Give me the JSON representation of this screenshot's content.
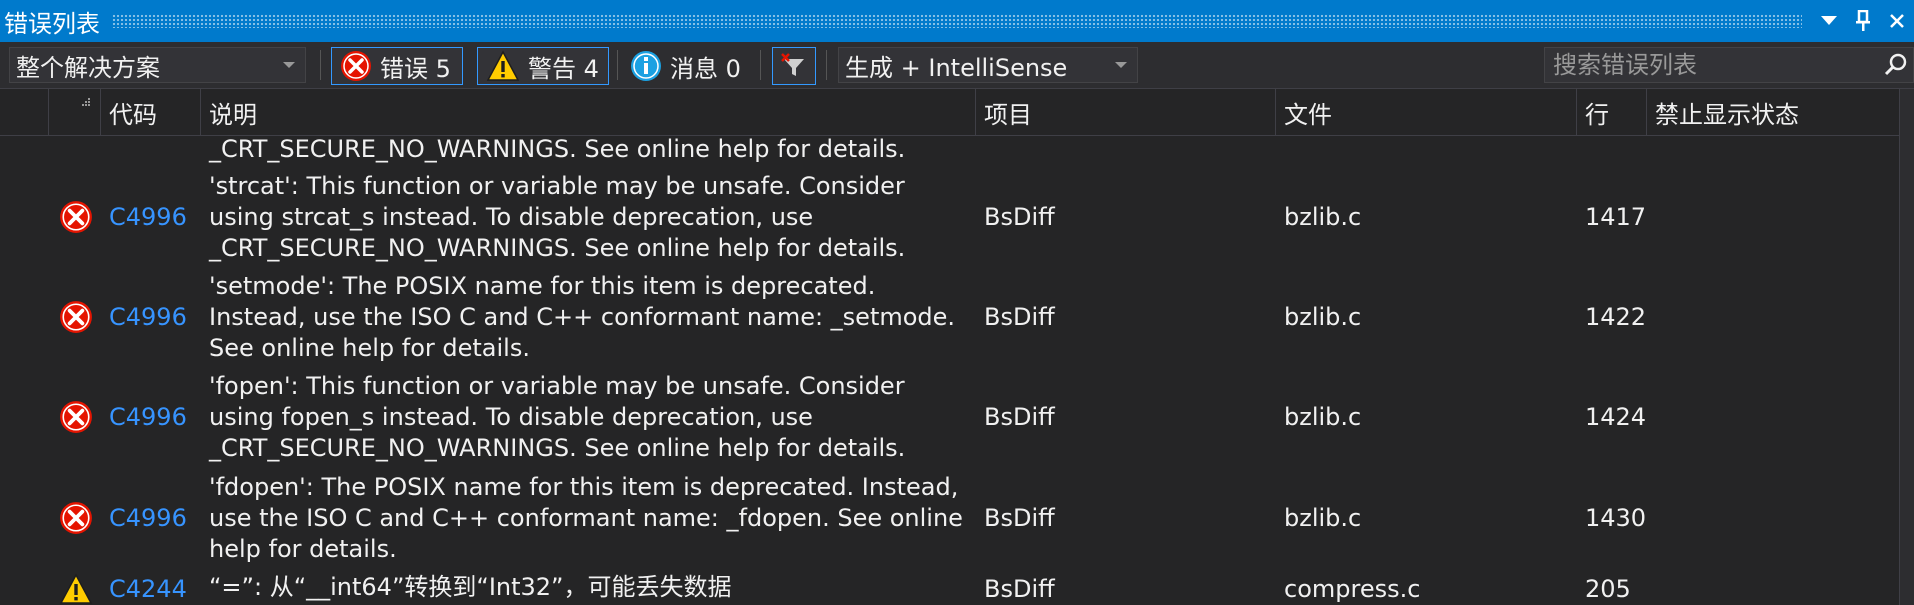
{
  "title": {
    "text": "错误列表",
    "dropdown_icon": "dropdown-arrow-icon",
    "pin_icon": "pin-icon"
  },
  "toolbar": {
    "scope": "整个解决方案",
    "errors": "错误 5",
    "warnings": "警告 4",
    "messages": "消息 0",
    "source": "生成 + IntelliSense",
    "search_placeholder": "搜索错误列表"
  },
  "columns": [
    "代码",
    "说明",
    "项目",
    "文件",
    "行",
    "禁止显示状态"
  ],
  "partial_row": {
    "description": "_CRT_SECURE_NO_WARNINGS. See online help for details."
  },
  "rows": [
    {
      "severity": "error",
      "code": "C4996",
      "description": "'strcat': This function or variable may be unsafe. Consider using strcat_s instead. To disable deprecation, use _CRT_SECURE_NO_WARNINGS. See online help for details.",
      "project": "BsDiff",
      "file": "bzlib.c",
      "line": "1417",
      "suppression": ""
    },
    {
      "severity": "error",
      "code": "C4996",
      "description": "'setmode': The POSIX name for this item is deprecated. Instead, use the ISO C and C++ conformant name: _setmode. See online help for details.",
      "project": "BsDiff",
      "file": "bzlib.c",
      "line": "1422",
      "suppression": ""
    },
    {
      "severity": "error",
      "code": "C4996",
      "description": "'fopen': This function or variable may be unsafe. Consider using fopen_s instead. To disable deprecation, use _CRT_SECURE_NO_WARNINGS. See online help for details.",
      "project": "BsDiff",
      "file": "bzlib.c",
      "line": "1424",
      "suppression": ""
    },
    {
      "severity": "error",
      "code": "C4996",
      "description": "'fdopen': The POSIX name for this item is deprecated. Instead, use the ISO C and C++ conformant name: _fdopen. See online help for details.",
      "project": "BsDiff",
      "file": "bzlib.c",
      "line": "1430",
      "suppression": ""
    },
    {
      "severity": "warning",
      "code": "C4244",
      "description": "“=”: 从“__int64”转换到“Int32”，可能丢失数据",
      "project": "BsDiff",
      "file": "compress.c",
      "line": "205",
      "suppression": ""
    }
  ],
  "colors": {
    "accent": "#007acc",
    "background": "#252526",
    "error": "#e51400",
    "warning": "#ffcc00",
    "info": "#1ba1e2",
    "link": "#3794ff"
  }
}
